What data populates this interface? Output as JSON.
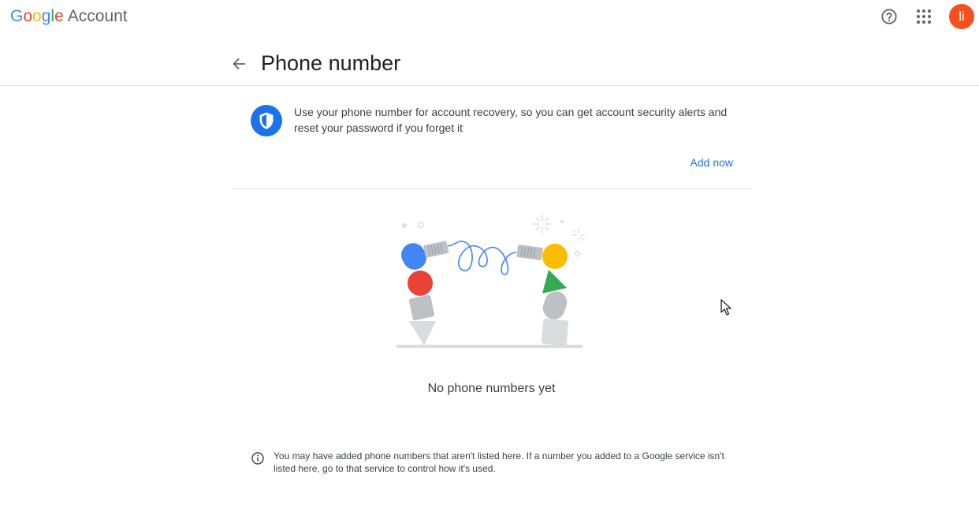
{
  "brand": {
    "logo_letters": [
      {
        "char": "G",
        "color": "#4285f4"
      },
      {
        "char": "o",
        "color": "#ea4335"
      },
      {
        "char": "o",
        "color": "#fbbc05"
      },
      {
        "char": "g",
        "color": "#4285f4"
      },
      {
        "char": "l",
        "color": "#34a853"
      },
      {
        "char": "e",
        "color": "#ea4335"
      }
    ],
    "product": "Account"
  },
  "header": {
    "help_icon": "help-circle-icon",
    "apps_icon": "apps-grid-icon",
    "avatar_initial": "li",
    "avatar_color": "#f4511e"
  },
  "page": {
    "back_icon": "arrow-back-icon",
    "title": "Phone number"
  },
  "info_card": {
    "icon": "shield-icon",
    "text": "Use your phone number for account recovery, so you can get account security alerts and reset your password if you forget it",
    "action_label": "Add now"
  },
  "empty_state": {
    "label": "No phone numbers yet"
  },
  "footnote": {
    "icon": "info-icon",
    "text": "You may have added phone numbers that aren't listed here. If a number you added to a Google service isn't listed here, go to that service to control how it's used."
  },
  "colors": {
    "accent": "#1a73e8",
    "google_blue": "#4285f4",
    "google_red": "#ea4335",
    "google_yellow": "#fbbc04",
    "google_green": "#34a853",
    "divider": "#dadce0"
  }
}
